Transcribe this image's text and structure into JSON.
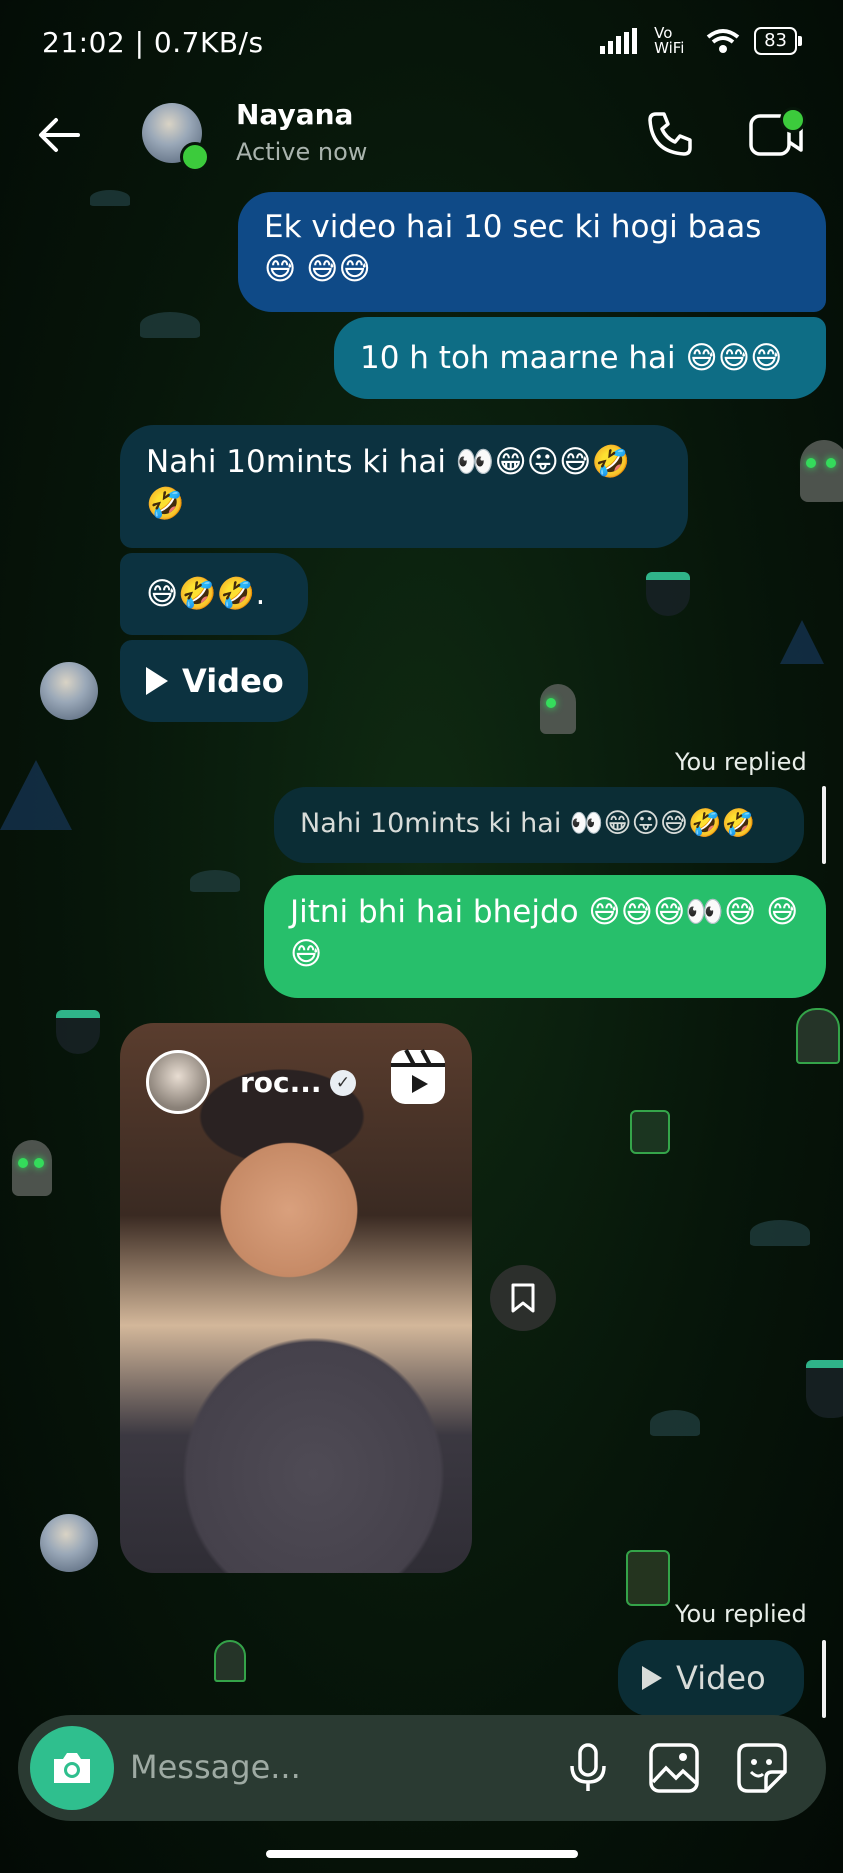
{
  "status_bar": {
    "time": "21:02 | 0.7KB/s",
    "network": "Vo WiFi",
    "battery": "83"
  },
  "header": {
    "name": "Nayana",
    "status": "Active now"
  },
  "messages": {
    "m1": "Ek video hai 10 sec ki hogi baas 😅 😅😅",
    "m2": "10 h toh maarne hai 😅😅😅",
    "m3": "Nahi 10mints ki hai 👀😁😛😅🤣 🤣",
    "m4": "😅🤣🤣.",
    "m5": "Video",
    "replied_label_1": "You replied",
    "reply_quote": "Nahi 10mints ki hai 👀😁😛😅🤣🤣",
    "m6": "Jitni bhi hai bhejdo 😅😅😅👀😅 😅😅",
    "reel_user": "roc...",
    "replied_label_2": "You replied",
    "m7": "Video"
  },
  "composer": {
    "placeholder": "Message..."
  },
  "colors": {
    "sent": "#0f4a87",
    "sent_alt": "#0e6d85",
    "received": "#0c3240",
    "sent_green": "#27bf6b",
    "accent": "#2fbf8e"
  }
}
